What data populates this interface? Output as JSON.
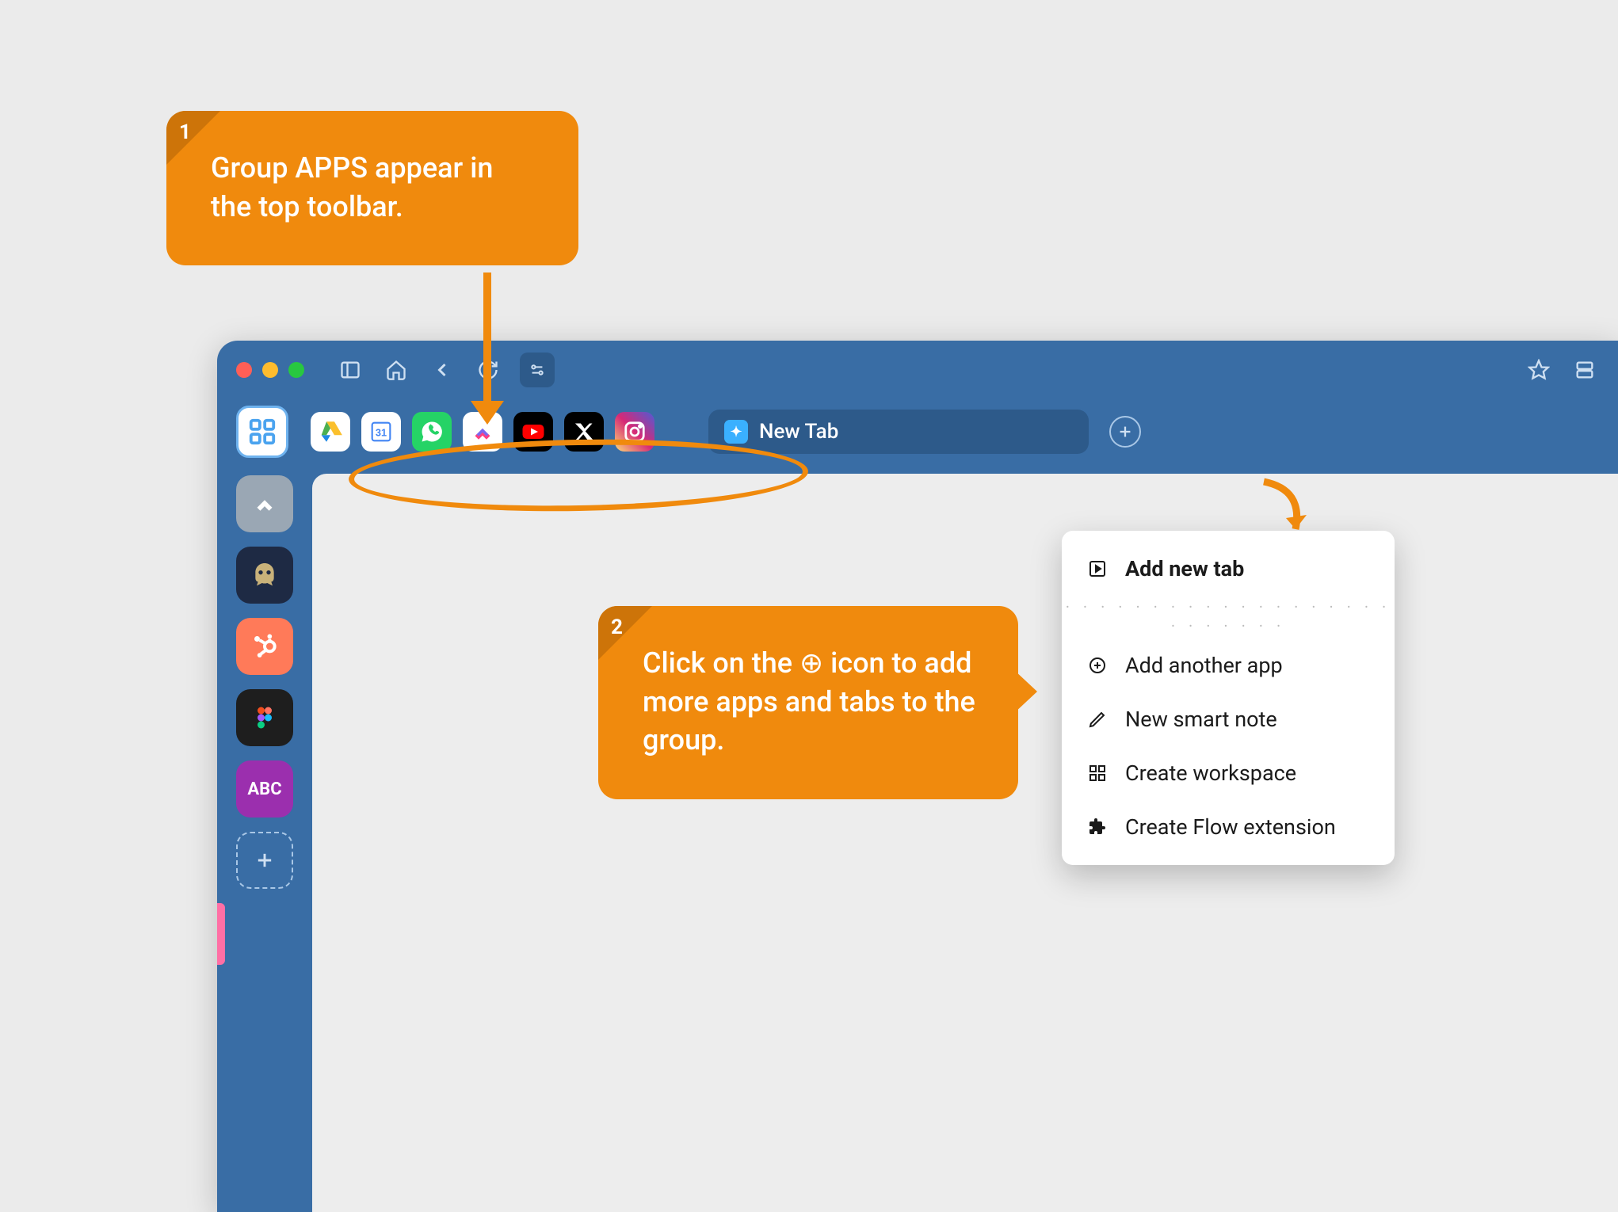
{
  "callouts": [
    {
      "num": "1",
      "text": "Group APPS appear in the top toolbar."
    },
    {
      "num": "2",
      "text": "Click on the ⊕ icon to add more apps and tabs to the group."
    }
  ],
  "tab": {
    "label": "New Tab"
  },
  "toolbar_apps": [
    {
      "name": "google-drive"
    },
    {
      "name": "google-calendar"
    },
    {
      "name": "whatsapp"
    },
    {
      "name": "clickup"
    },
    {
      "name": "youtube"
    },
    {
      "name": "x-twitter"
    },
    {
      "name": "instagram"
    }
  ],
  "sidebar": [
    {
      "name": "clickup"
    },
    {
      "name": "hootsuite"
    },
    {
      "name": "hubspot"
    },
    {
      "name": "figma"
    },
    {
      "name": "abc",
      "label": "ABC"
    }
  ],
  "dropdown": {
    "items": [
      {
        "label": "Add new tab",
        "bold": true,
        "icon": "play-box"
      },
      {
        "label": "Add another app",
        "icon": "plus-circle"
      },
      {
        "label": "New smart note",
        "icon": "pencil"
      },
      {
        "label": "Create workspace",
        "icon": "grid"
      },
      {
        "label": "Create Flow extension",
        "icon": "puzzle"
      }
    ]
  },
  "colors": {
    "accent": "#f08a0d",
    "chrome": "#396da5"
  }
}
